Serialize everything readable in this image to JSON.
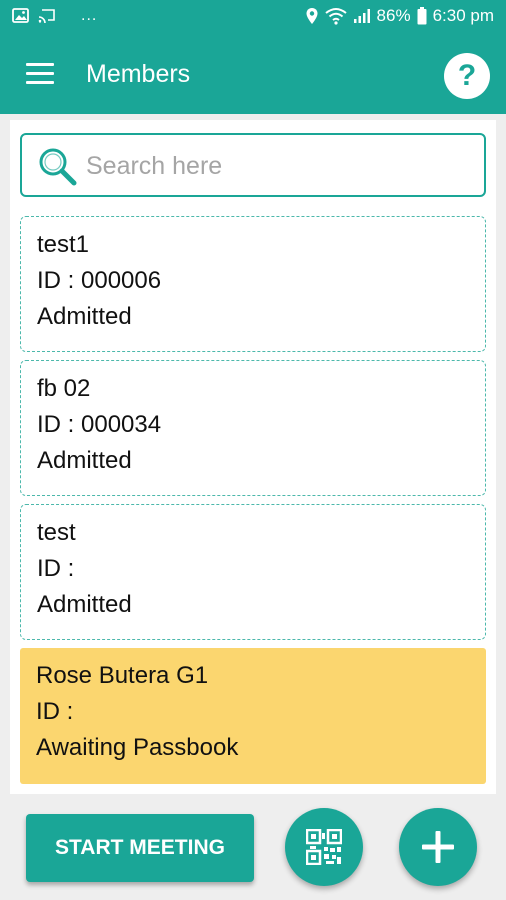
{
  "status_bar": {
    "notification_icons": [
      "image-icon",
      "cast-icon"
    ],
    "dots": "...",
    "battery": "86%",
    "time": "6:30 pm"
  },
  "app_bar": {
    "title": "Members",
    "help_label": "?"
  },
  "search": {
    "placeholder": "Search here",
    "value": ""
  },
  "members": [
    {
      "name": "test1",
      "id": "ID : 000006",
      "status": "Admitted"
    },
    {
      "name": "fb 02",
      "id": "ID : 000034",
      "status": "Admitted"
    },
    {
      "name": "test",
      "id": "ID :",
      "status": "Admitted"
    },
    {
      "name": "Rose Butera G1",
      "id": "ID :",
      "status": "Awaiting Passbook"
    }
  ],
  "actions": {
    "start_meeting": "START MEETING",
    "qr_icon": "qr-code-icon",
    "add_icon": "plus-icon"
  },
  "colors": {
    "primary": "#1aa697",
    "awaiting_background": "#fbd66f",
    "card_border": "#4cb8ab",
    "background": "#eeeeee"
  }
}
